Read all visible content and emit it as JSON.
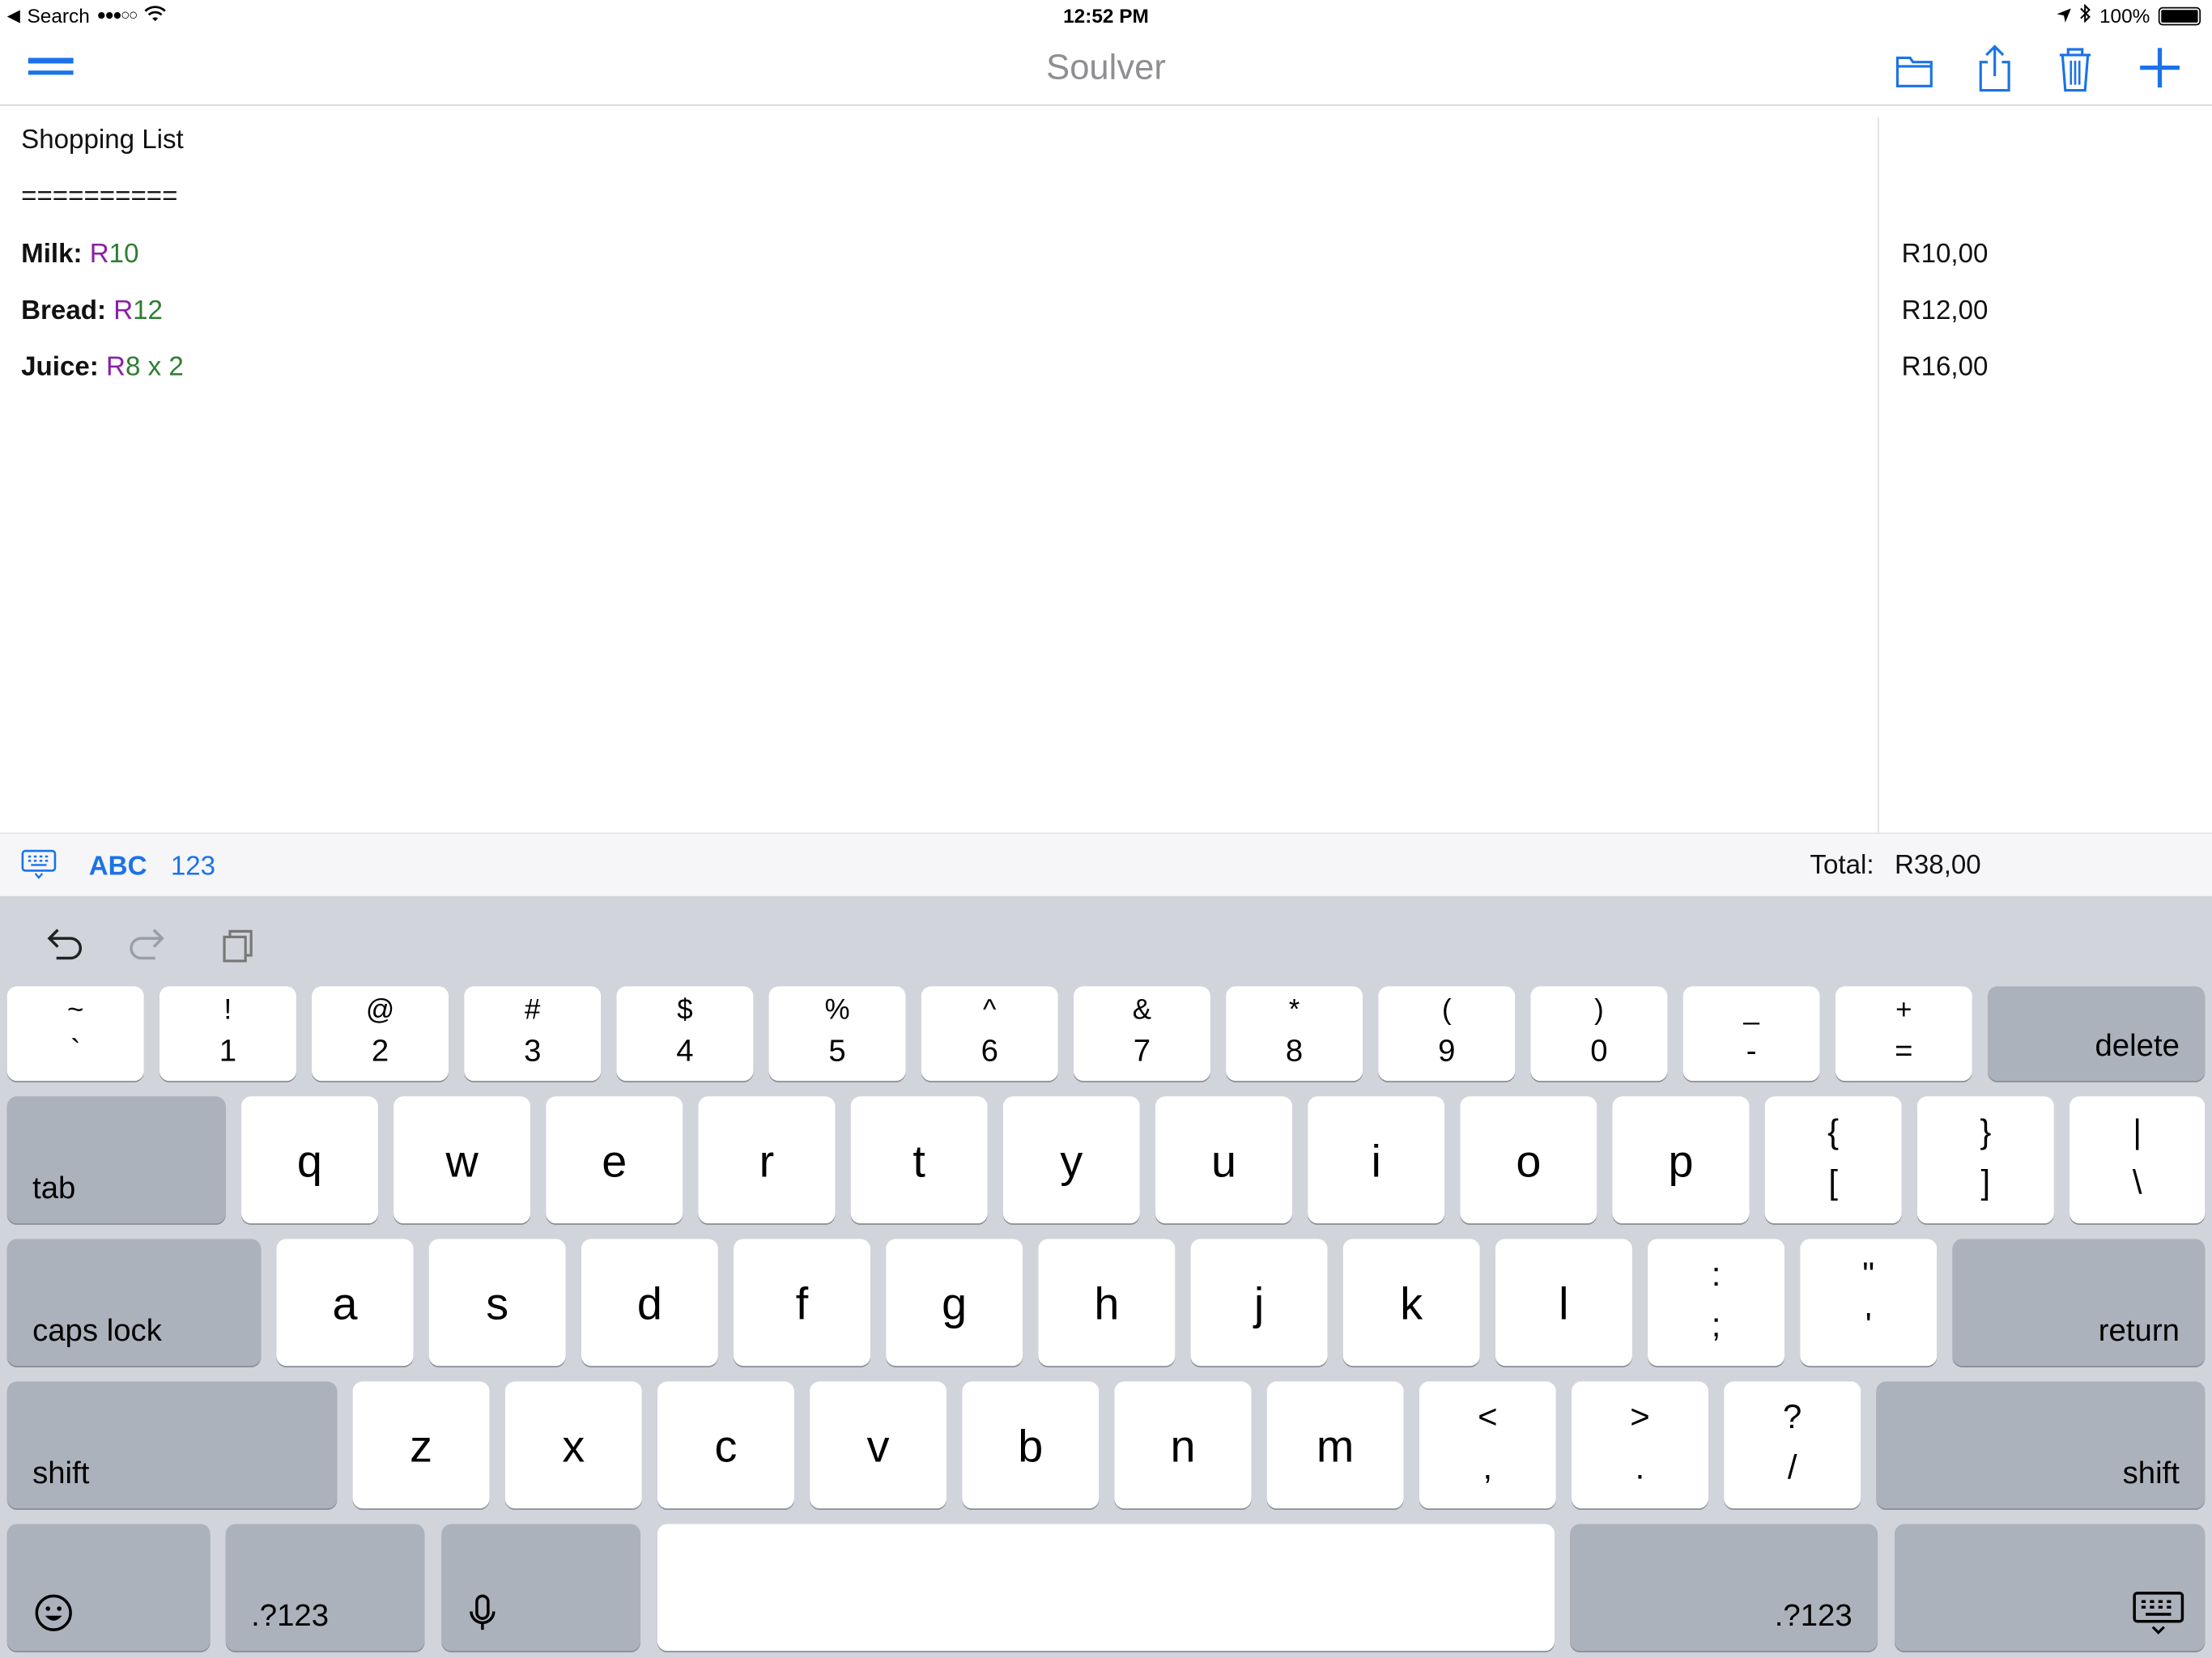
{
  "status_bar": {
    "back_label": "Search",
    "time": "12:52 PM",
    "battery": "100%",
    "signal_dots": "●●●○○"
  },
  "navbar": {
    "title": "Soulver",
    "menu_icon": "hamburger-icon",
    "actions": [
      "folder-icon",
      "share-icon",
      "trash-icon",
      "plus-icon"
    ]
  },
  "document": {
    "title": "Shopping List",
    "separator": "==========",
    "lines": [
      {
        "label": "Milk:",
        "currency": "R",
        "amount": "10",
        "rest": "",
        "result": "R10,00"
      },
      {
        "label": "Bread:",
        "currency": "R",
        "amount": "12",
        "rest": "",
        "result": "R12,00"
      },
      {
        "label": "Juice:",
        "currency": "R",
        "amount": "8",
        "rest": " x 2",
        "result": "R16,00"
      }
    ]
  },
  "accessory_bar": {
    "abc": "ABC",
    "num": "123",
    "total_label": "Total:",
    "total_value": "R38,00"
  },
  "keyboard": {
    "number_row": [
      {
        "up": "~",
        "down": "`"
      },
      {
        "up": "!",
        "down": "1"
      },
      {
        "up": "@",
        "down": "2"
      },
      {
        "up": "#",
        "down": "3"
      },
      {
        "up": "$",
        "down": "4"
      },
      {
        "up": "%",
        "down": "5"
      },
      {
        "up": "^",
        "down": "6"
      },
      {
        "up": "&",
        "down": "7"
      },
      {
        "up": "*",
        "down": "8"
      },
      {
        "up": "(",
        "down": "9"
      },
      {
        "up": ")",
        "down": "0"
      },
      {
        "up": "_",
        "down": "-"
      },
      {
        "up": "+",
        "down": "="
      }
    ],
    "delete": "delete",
    "tab": "tab",
    "row_q": [
      "q",
      "w",
      "e",
      "r",
      "t",
      "y",
      "u",
      "i",
      "o",
      "p"
    ],
    "row_q_sym": [
      {
        "up": "{",
        "down": "["
      },
      {
        "up": "}",
        "down": "]"
      },
      {
        "up": "|",
        "down": "\\"
      }
    ],
    "caps": "caps lock",
    "row_a": [
      "a",
      "s",
      "d",
      "f",
      "g",
      "h",
      "j",
      "k",
      "l"
    ],
    "row_a_sym": [
      {
        "up": ":",
        "down": ";"
      },
      {
        "up": "\"",
        "down": "'"
      }
    ],
    "return": "return",
    "shift": "shift",
    "row_z": [
      "z",
      "x",
      "c",
      "v",
      "b",
      "n",
      "m"
    ],
    "row_z_sym": [
      {
        "up": "<",
        "down": ","
      },
      {
        "up": ">",
        "down": "."
      },
      {
        "up": "?",
        "down": "/"
      }
    ],
    "num_switch": ".?123"
  },
  "colors": {
    "accent": "#1a73e8",
    "currency": "#8a1fa8",
    "number": "#2e7d32",
    "keyboard_bg": "#d1d4da",
    "fn_key": "#acb2bb"
  }
}
